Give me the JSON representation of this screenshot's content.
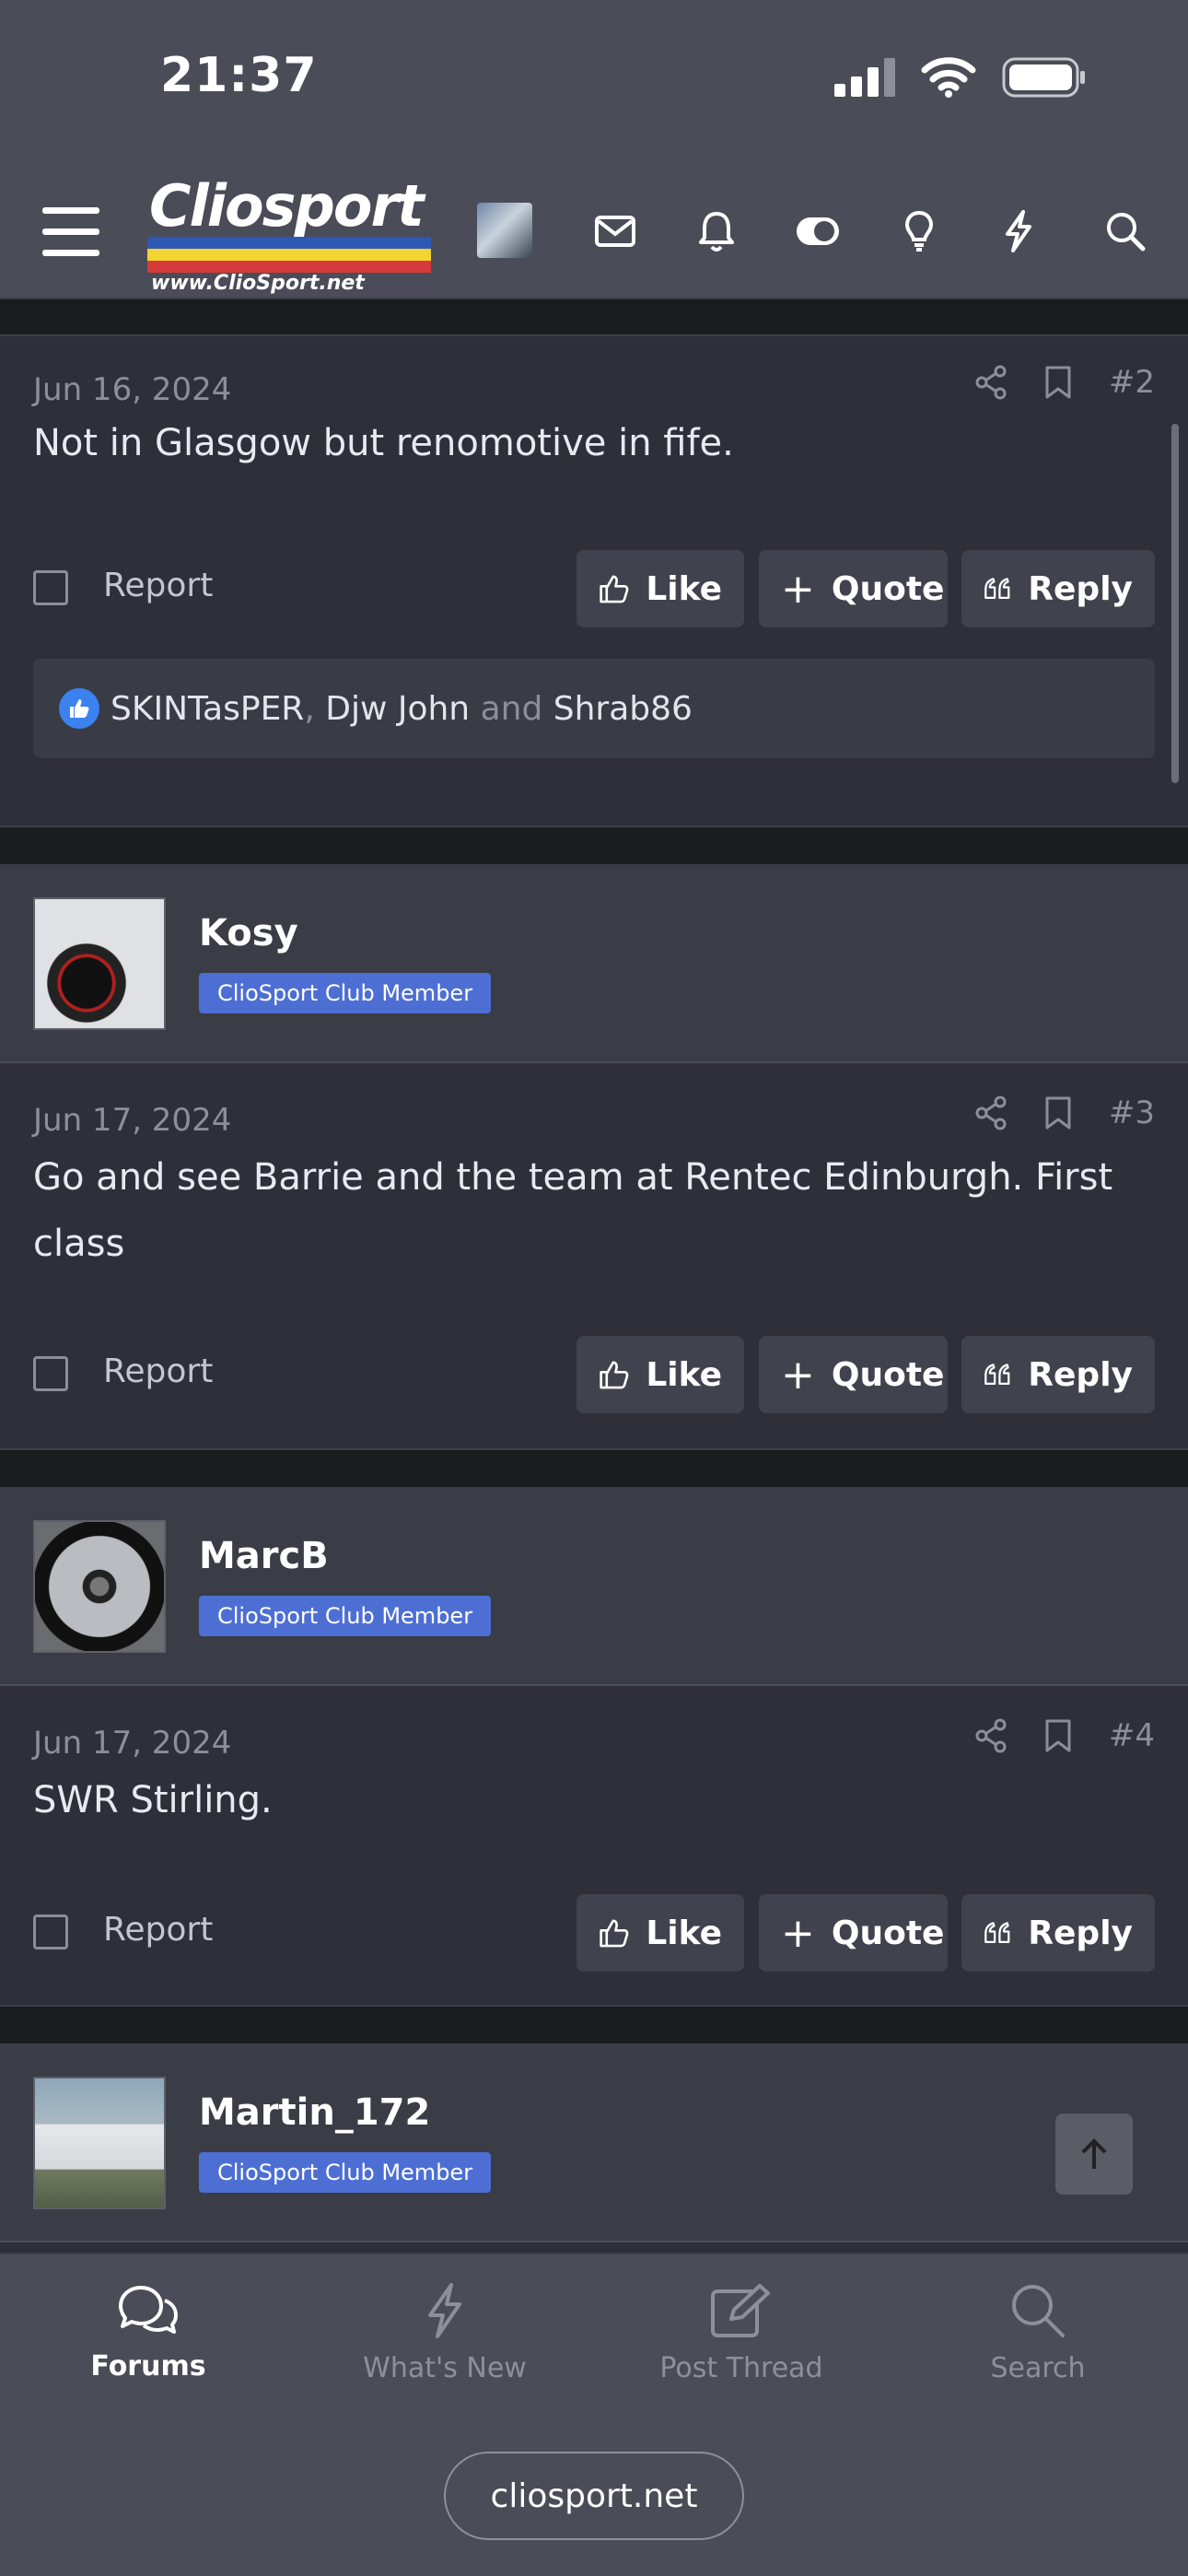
{
  "status_bar": {
    "time": "21:37"
  },
  "nav": {
    "logo_word": "Cliosport",
    "logo_url": "www.ClioSport.net"
  },
  "posts": [
    {
      "date": "Jun 16, 2024",
      "number": "#2",
      "text": "Not in Glasgow but renomotive in fife.",
      "reactions": {
        "names": [
          "SKINTasPER",
          "Djw John",
          "Shrab86"
        ],
        "sep_comma": ",",
        "sep_and": "and"
      }
    },
    {
      "user": "Kosy",
      "badge": "ClioSport Club Member",
      "date": "Jun 17, 2024",
      "number": "#3",
      "text": "Go and see Barrie and the team at Rentec Edinburgh. First class"
    },
    {
      "user": "MarcB",
      "badge": "ClioSport Club Member",
      "date": "Jun 17, 2024",
      "number": "#4",
      "text": "SWR Stirling."
    },
    {
      "user": "Martin_172",
      "badge": "ClioSport Club Member"
    }
  ],
  "actions": {
    "report": "Report",
    "like": "Like",
    "quote": "Quote",
    "reply": "Reply"
  },
  "tabs": [
    {
      "label": "Forums",
      "icon": "chat-bubbles-icon",
      "active": true
    },
    {
      "label": "What's New",
      "icon": "bolt-icon",
      "active": false
    },
    {
      "label": "Post Thread",
      "icon": "edit-icon",
      "active": false
    },
    {
      "label": "Search",
      "icon": "search-icon",
      "active": false
    }
  ],
  "browser": {
    "url": "cliosport.net"
  },
  "colors": {
    "badge": "#4d6fd4",
    "accent_like": "#3b82f0",
    "nav_bg": "#4a4c57"
  }
}
